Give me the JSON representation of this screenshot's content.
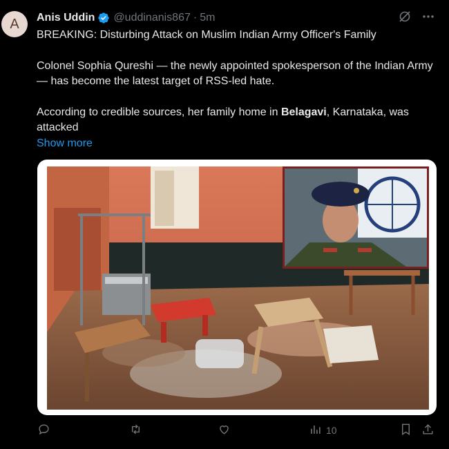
{
  "tweet": {
    "avatar_letter": "A",
    "author_name": "Anis Uddin",
    "handle": "@uddinanis867",
    "separator": "·",
    "time": "5m",
    "line1": "BREAKING: Disturbing Attack on Muslim Indian Army Officer's Family",
    "para2": "Colonel Sophia Qureshi — the newly appointed spokesperson of the Indian Army — has become the latest target of RSS-led hate.",
    "para3_before": "According to credible sources, her family home in ",
    "para3_bold": "Belagavi",
    "para3_after": ", Karnataka, was attacked",
    "show_more": "Show more"
  },
  "actions": {
    "views_count": "10"
  },
  "icons": {
    "verified": "verified-badge-icon",
    "grok": "grok-icon",
    "more": "more-dots-icon",
    "reply": "reply-icon",
    "retweet": "retweet-icon",
    "like": "like-icon",
    "views": "views-icon",
    "bookmark": "bookmark-icon",
    "share": "share-icon"
  },
  "colors": {
    "background": "#000000",
    "text": "#e7e9ea",
    "muted": "#71767b",
    "link": "#1d9bf0",
    "verified": "#1d9bf0"
  }
}
